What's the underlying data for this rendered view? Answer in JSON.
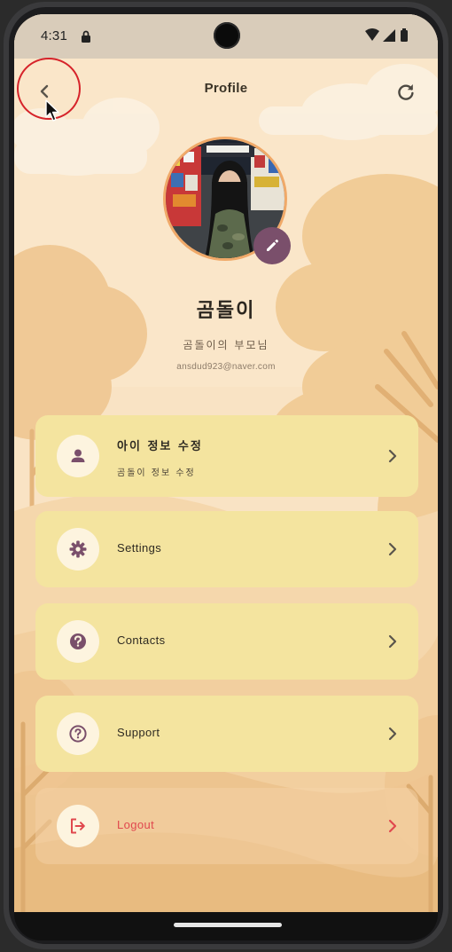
{
  "status_bar": {
    "time": "4:31",
    "icons": [
      "lock-icon",
      "wifi-icon",
      "signal-icon",
      "battery-icon"
    ]
  },
  "app_bar": {
    "title": "Profile",
    "back_icon": "arrow-back-icon",
    "refresh_icon": "refresh-icon"
  },
  "profile": {
    "name": "곰돌이",
    "subtitle": "곰돌이의 부모님",
    "email": "ansdud923@naver.com",
    "edit_icon": "pencil-icon"
  },
  "menu": {
    "items": [
      {
        "label": "아이 정보 수정",
        "sub": "곰돌이 정보 수정",
        "icon": "person-icon"
      },
      {
        "label": "Settings",
        "icon": "gear-icon"
      },
      {
        "label": "Contacts",
        "icon": "help-filled-icon"
      },
      {
        "label": "Support",
        "icon": "help-outline-icon"
      },
      {
        "label": "Logout",
        "icon": "logout-icon"
      }
    ]
  },
  "colors": {
    "card": "#f4e49f",
    "accent": "#7a4f6b",
    "logout": "#e0484e",
    "highlight_ring": "#d6232a",
    "background": "#f8e2c3"
  }
}
